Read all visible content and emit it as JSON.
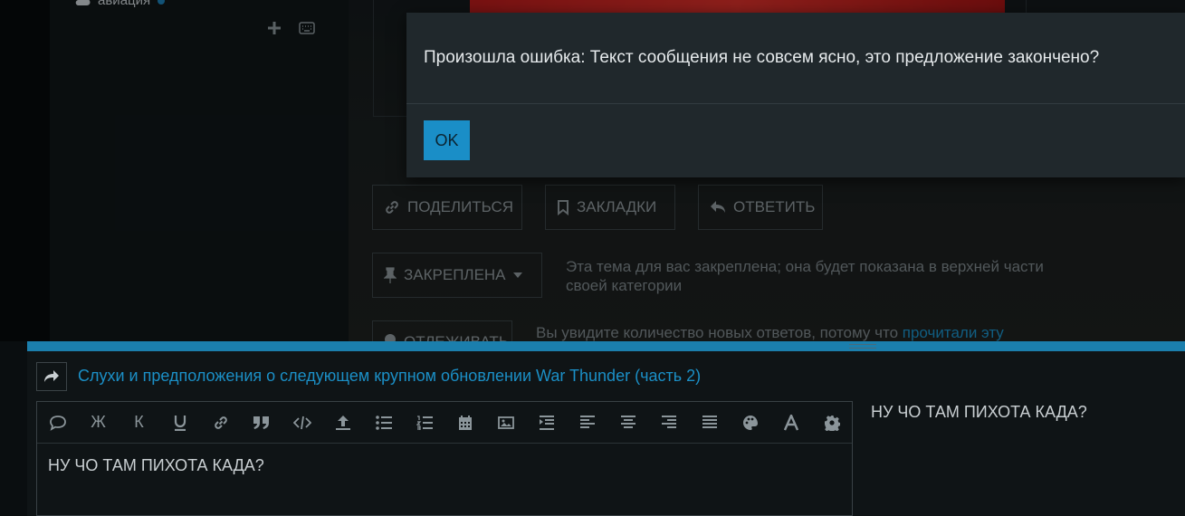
{
  "sidebar": {
    "category_label": "авиация",
    "add_icon": "plus-icon",
    "keyboard_icon": "keyboard-icon"
  },
  "topic_actions": {
    "share_label": "ПОДЕЛИТЬСЯ",
    "bookmark_label": "ЗАКЛАДКИ",
    "reply_label": "ОТВЕТИТЬ"
  },
  "notifications": {
    "pinned_label": "ЗАКРЕПЛЕНА",
    "pinned_description": "Эта тема для вас закреплена; она будет показана в верхней части своей категории",
    "tracking_label": "ОТЛЕЖИВАТЬ",
    "tracking_description": "Вы увидите количество новых ответов, потому что ",
    "tracking_link": "прочитали эту"
  },
  "modal": {
    "message": "Произошла ошибка: Текст сообщения не совсем ясно, это предложение закончено?",
    "ok_label": "OK"
  },
  "composer": {
    "reply_to_title": "Слухи и предположения о следующем крупном обновлении War Thunder (часть 2)",
    "toolbar": [
      {
        "name": "quote-icon",
        "glyph": ""
      },
      {
        "name": "bold-button",
        "glyph": "Ж"
      },
      {
        "name": "italic-button",
        "glyph": "К"
      },
      {
        "name": "underline-icon",
        "glyph": ""
      },
      {
        "name": "link-icon",
        "glyph": ""
      },
      {
        "name": "blockquote-icon",
        "glyph": ""
      },
      {
        "name": "code-icon",
        "glyph": ""
      },
      {
        "name": "upload-icon",
        "glyph": ""
      },
      {
        "name": "bullet-list-icon",
        "glyph": ""
      },
      {
        "name": "numbered-list-icon",
        "glyph": ""
      },
      {
        "name": "calendar-icon",
        "glyph": ""
      },
      {
        "name": "image-icon",
        "glyph": ""
      },
      {
        "name": "indent-icon",
        "glyph": ""
      },
      {
        "name": "align-left-icon",
        "glyph": ""
      },
      {
        "name": "align-center-icon",
        "glyph": ""
      },
      {
        "name": "align-right-icon",
        "glyph": ""
      },
      {
        "name": "align-justify-icon",
        "glyph": ""
      },
      {
        "name": "palette-icon",
        "glyph": ""
      },
      {
        "name": "font-icon",
        "glyph": ""
      },
      {
        "name": "gear-icon",
        "glyph": ""
      }
    ],
    "editor_text": "НУ ЧО ТАМ ПИХОТА КАДА?",
    "preview_text": "НУ ЧО ТАМ ПИХОТА КАДА?"
  },
  "colors": {
    "accent": "#1a8ec7",
    "modal_bg": "#20282c",
    "page_bg": "#0a0e10"
  }
}
